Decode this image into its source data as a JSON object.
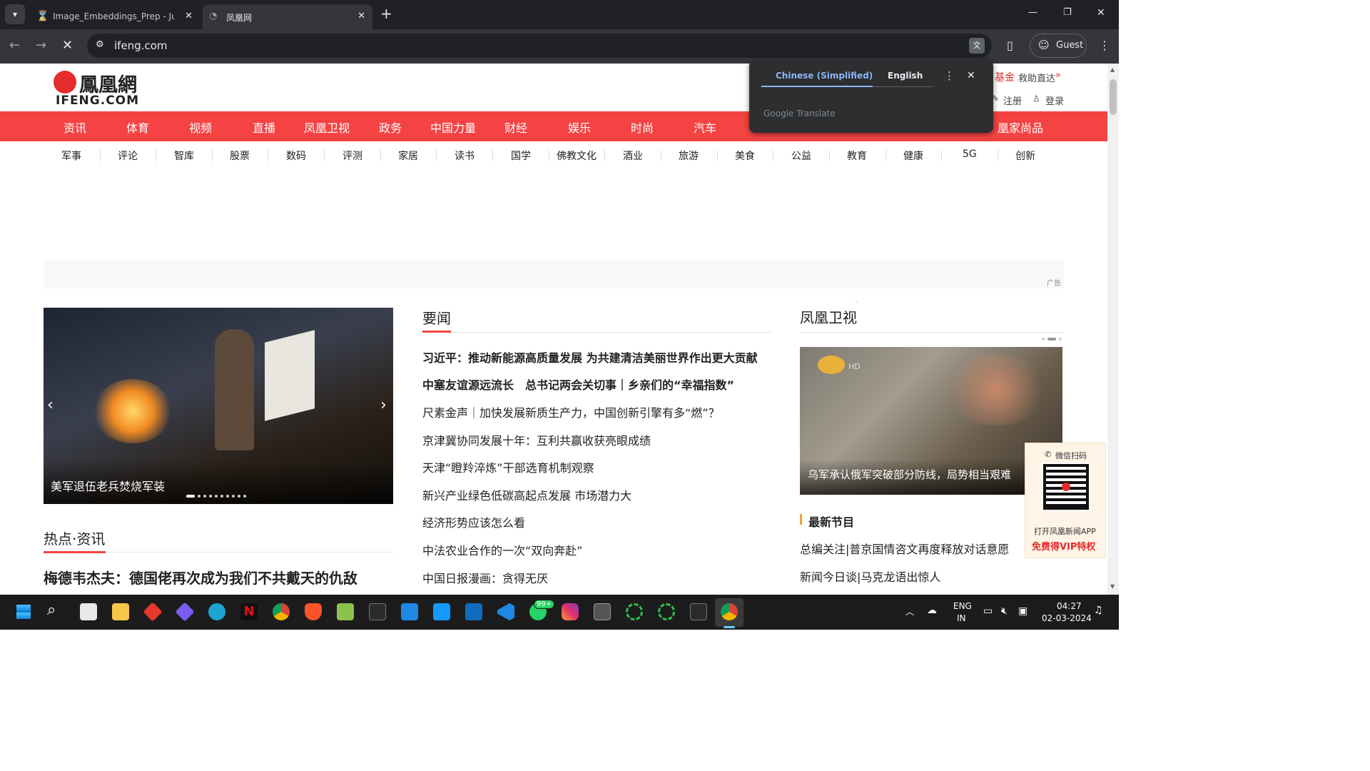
{
  "browser": {
    "tabs": [
      {
        "title": "Image_Embeddings_Prep - Jupy",
        "active": false
      },
      {
        "title": "凤凰网",
        "active": true
      }
    ],
    "new_tab": "+",
    "url": "ifeng.com",
    "profile_label": "Guest",
    "window_controls": [
      "—",
      "❐",
      "✕"
    ]
  },
  "translate_popup": {
    "source_tab": "Chinese (Simplified)",
    "target_tab": "English",
    "footer": "Google Translate"
  },
  "site": {
    "logo_cn": "鳳凰網",
    "logo_en": "IFENG.COM",
    "top_links": {
      "fund": "基金",
      "rescue": "救助直达",
      "register": "注册",
      "login": "登录"
    },
    "nav_primary": [
      "资讯",
      "体育",
      "视频",
      "直播",
      "凤凰卫视",
      "政务",
      "中国力量",
      "财经",
      "娱乐",
      "时尚",
      "汽车",
      "凰家尚品"
    ],
    "nav_secondary": [
      "军事",
      "评论",
      "智库",
      "股票",
      "数码",
      "评测",
      "家居",
      "读书",
      "国学",
      "佛教文化",
      "酒业",
      "旅游",
      "美食",
      "公益",
      "教育",
      "健康",
      "5G",
      "创新"
    ],
    "ad_label": "广告",
    "carousel": {
      "caption": "美军退伍老兵焚烧军装",
      "dots": 11
    },
    "hot": {
      "title": "热点·资讯",
      "headline": "梅德韦杰夫：德国佬再次成为我们不共戴天的仇敌"
    },
    "yaowen": {
      "title": "要闻",
      "items": [
        {
          "text": "习近平：推动新能源高质量发展 为共建清洁美丽世界作出更大贡献",
          "bold": true
        },
        {
          "text": "中塞友谊源远流长　总书记两会关切事｜乡亲们的“幸福指数”",
          "bold": true
        },
        {
          "text": "尺素金声｜加快发展新质生产力，中国创新引擎有多“燃”？",
          "bold": false
        },
        {
          "text": "京津冀协同发展十年：互利共赢收获亮眼成绩",
          "bold": false
        },
        {
          "text": "天津“瞪羚淬炼”干部选育机制观察",
          "bold": false
        },
        {
          "text": "新兴产业绿色低碳高起点发展 市场潜力大",
          "bold": false
        },
        {
          "text": "经济形势应该怎么看",
          "bold": false
        },
        {
          "text": "中法农业合作的一次“双向奔赴”",
          "bold": false
        },
        {
          "text": "中国日报漫画：贪得无厌",
          "bold": false
        }
      ]
    },
    "phoenix_tv": {
      "title": "凤凰卫视",
      "video_caption": "乌军承认俄军突破部分防线，局势相当艰难",
      "hd": "HD",
      "latest_title": "最新节目",
      "latest": [
        "总编关注|普京国情咨文再度释放对话意愿",
        "新闻今日谈|马克龙语出惊人"
      ]
    },
    "qr_card": {
      "top": "微信扫码",
      "line1": "打开凤凰新闻APP",
      "line2": "免费得VIP特权"
    }
  },
  "taskbar": {
    "lang_top": "ENG",
    "lang_bottom": "IN",
    "time": "04:27",
    "date": "02-03-2024",
    "whatsapp_badge": "99+"
  },
  "colors": {
    "brand_red": "#f54343",
    "chrome_dark": "#202124",
    "chrome_toolbar": "#35363a",
    "translate_blue": "#8ab4f8"
  }
}
